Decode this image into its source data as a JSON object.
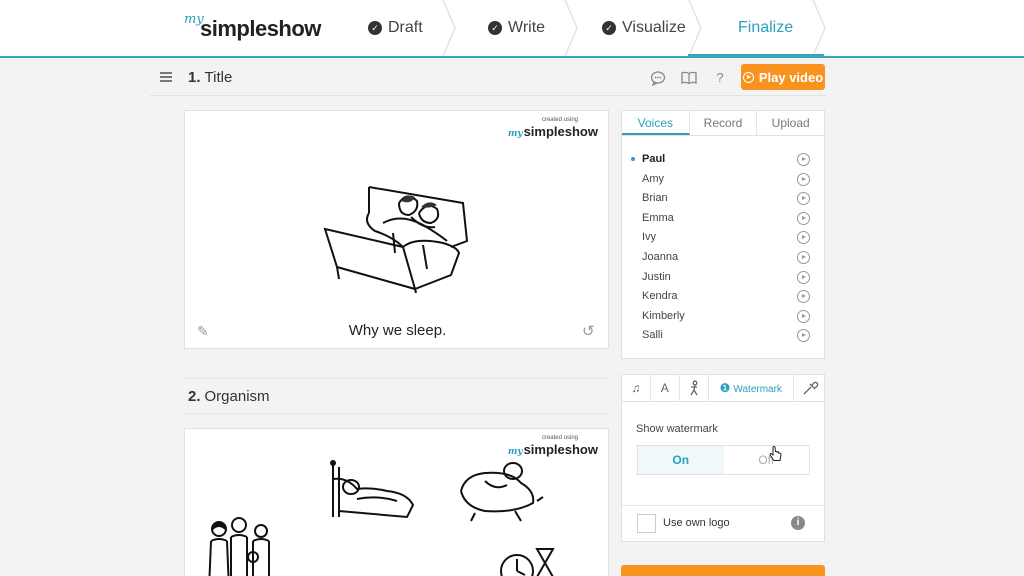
{
  "header": {
    "logo_my": "my",
    "logo_name": "simpleshow",
    "steps": [
      {
        "label": "Draft",
        "done": true
      },
      {
        "label": "Write",
        "done": true
      },
      {
        "label": "Visualize",
        "done": true
      },
      {
        "label": "Finalize",
        "done": false,
        "active": true
      }
    ],
    "accent": "#3aa3bd"
  },
  "toolbar": {
    "play_label": "Play video",
    "icons": [
      "comment-icon",
      "book-icon",
      "help-icon"
    ]
  },
  "scenes": [
    {
      "number": "1.",
      "title": "Title",
      "caption": "Why we sleep."
    },
    {
      "number": "2.",
      "title": "Organism"
    }
  ],
  "watermark": {
    "created_using": "created using",
    "my": "my",
    "name": "simpleshow"
  },
  "voices_panel": {
    "tabs": [
      "Voices",
      "Record",
      "Upload"
    ],
    "selected": "Paul",
    "voices": [
      "Paul",
      "Amy",
      "Brian",
      "Emma",
      "Ivy",
      "Joanna",
      "Justin",
      "Kendra",
      "Kimberly",
      "Salli"
    ]
  },
  "settings_panel": {
    "tabs": [
      "music-icon",
      "text-icon",
      "figure-icon",
      "Watermark",
      "eyedropper-icon"
    ],
    "watermark_tab_label": "Watermark",
    "show_watermark_label": "Show watermark",
    "toggle_on": "On",
    "toggle_off": "Off",
    "toggle_value": "On",
    "own_logo_label": "Use own logo",
    "info_glyph": "i"
  },
  "colors": {
    "orange": "#f7931e",
    "teal": "#2aa1c0"
  }
}
